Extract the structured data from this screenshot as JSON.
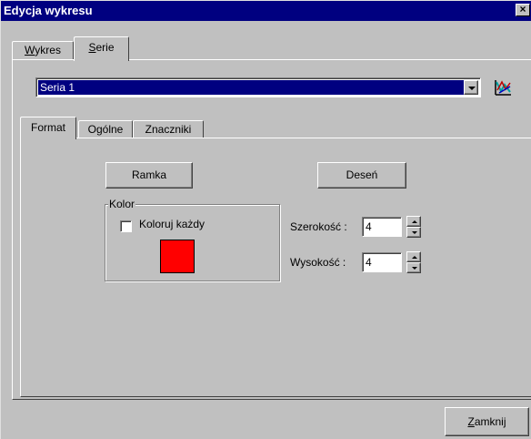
{
  "window": {
    "title": "Edycja wykresu",
    "close_glyph": "×"
  },
  "main_tabs": [
    {
      "label": "Wykres",
      "accel_index": 0,
      "active": false
    },
    {
      "label": "Serie",
      "accel_index": 0,
      "active": true
    }
  ],
  "series_select": {
    "selected": "Seria 1"
  },
  "chart_icon": "chart-icon",
  "sub_tabs": [
    {
      "label": "Format",
      "active": true
    },
    {
      "label": "Ogólne",
      "active": false
    },
    {
      "label": "Znaczniki",
      "active": false
    }
  ],
  "format": {
    "frame_button": "Ramka",
    "pattern_button": "Deseń",
    "color_group_label": "Kolor",
    "color_each_label": "Koloruj każdy",
    "color_each_checked": false,
    "swatch_color": "#ff0000",
    "width_label": "Szerokość :",
    "width_value": "4",
    "height_label": "Wysokość :",
    "height_value": "4"
  },
  "close_button": {
    "label": "Zamknij"
  }
}
